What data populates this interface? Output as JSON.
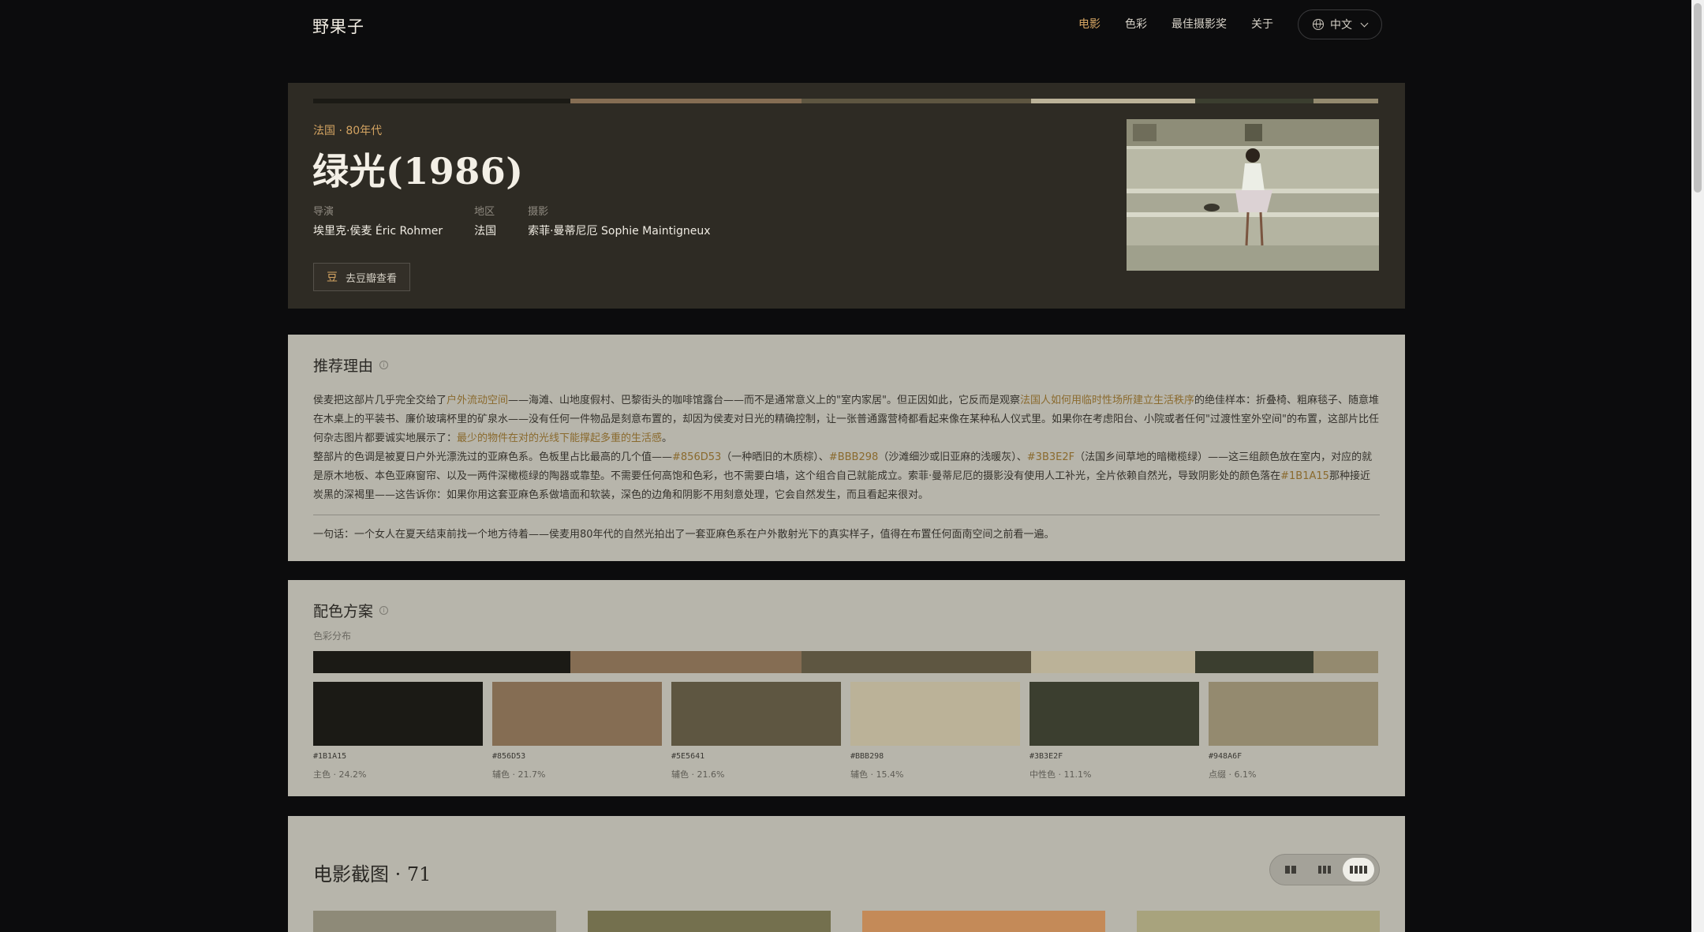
{
  "site": {
    "logo": "野果子"
  },
  "nav": {
    "items": [
      {
        "label": "电影",
        "active": true
      },
      {
        "label": "色彩",
        "active": false
      },
      {
        "label": "最佳摄影奖",
        "active": false
      },
      {
        "label": "关于",
        "active": false
      }
    ],
    "language": "中文"
  },
  "film": {
    "origin": "法国 · 80年代",
    "title": "绿光(1986)",
    "meta": [
      {
        "key": "导演",
        "value": "埃里克·侯麦 Éric Rohmer"
      },
      {
        "key": "地区",
        "value": "法国"
      },
      {
        "key": "摄影",
        "value": "索菲·曼蒂尼厄 Sophie Maintigneux"
      }
    ],
    "douban_icon": "豆",
    "douban_label": "去豆瓣查看"
  },
  "reason": {
    "title": "推荐理由",
    "p1": [
      {
        "t": "侯麦把这部片几乎完全交给了"
      },
      {
        "t": "户外流动空间",
        "hl": true
      },
      {
        "t": "——海滩、山地度假村、巴黎街头的咖啡馆露台——而不是通常意义上的\"室内家居\"。但正因如此，它反而是观察"
      },
      {
        "t": "法国人如何用临时性场所建立生活秩序",
        "hl": true
      },
      {
        "t": "的绝佳样本：折叠椅、粗麻毯子、随意堆在木桌上的平装书、廉价玻璃杯里的矿泉水——没有任何一件物品是刻意布置的，却因为侯麦对日光的精确控制，让一张普通露营椅都看起来像在某种私人仪式里。如果你在考虑阳台、小院或者任何\"过渡性室外空间\"的布置，这部片比任何杂志图片都要诚实地展示了："
      },
      {
        "t": "最少的物件在对的光线下能撑起多重的生活感",
        "hl": true
      },
      {
        "t": "。"
      }
    ],
    "p2": [
      {
        "t": "整部片的色调是被夏日户外光漂洗过的亚麻色系。色板里占比最高的几个值——"
      },
      {
        "t": "#856D53",
        "hl": true
      },
      {
        "t": "（一种晒旧的木质棕）、"
      },
      {
        "t": "#BBB298",
        "hl": true
      },
      {
        "t": "（沙滩细沙或旧亚麻的浅暖灰）、"
      },
      {
        "t": "#3B3E2F",
        "hl": true
      },
      {
        "t": "（法国乡间草地的暗橄榄绿）——这三组颜色放在室内，对应的就是原木地板、本色亚麻窗帘、以及一两件深橄榄绿的陶器或靠垫。不需要任何高饱和色彩，也不需要白墙，这个组合自己就能成立。索菲·曼蒂尼厄的摄影没有使用人工补光，全片依赖自然光，导致阴影处的颜色落在"
      },
      {
        "t": "#1B1A15",
        "hl": true
      },
      {
        "t": "那种接近炭黑的深褐里——这告诉你：如果你用这套亚麻色系做墙面和软装，深色的边角和阴影不用刻意处理，它会自然发生，而且看起来很对。"
      }
    ],
    "summary": "一句话：一个女人在夏天结束前找一个地方待着——侯麦用80年代的自然光拍出了一套亚麻色系在户外散射光下的真实样子，值得在布置任何面南空间之前看一遍。"
  },
  "scheme": {
    "title": "配色方案",
    "subtitle": "色彩分布",
    "colors": [
      {
        "hex": "#1B1A15",
        "role": "主色 · 24.2%",
        "pct": 24.2
      },
      {
        "hex": "#856D53",
        "role": "辅色 · 21.7%",
        "pct": 21.7
      },
      {
        "hex": "#5E5641",
        "role": "辅色 · 21.6%",
        "pct": 21.6
      },
      {
        "hex": "#BBB298",
        "role": "辅色 · 15.4%",
        "pct": 15.4
      },
      {
        "hex": "#3B3E2F",
        "role": "中性色 · 11.1%",
        "pct": 11.1
      },
      {
        "hex": "#948A6F",
        "role": "点缀 · 6.1%",
        "pct": 6.1
      }
    ]
  },
  "stills": {
    "title": "电影截图 · 71",
    "view_options": [
      "grid-2-icon",
      "grid-3-icon",
      "grid-4-icon"
    ],
    "active_view": 2,
    "thumb_colors": [
      "#8e8a78",
      "#74704e",
      "#c48a58",
      "#a8a37d"
    ]
  },
  "accent": "#d4a462"
}
